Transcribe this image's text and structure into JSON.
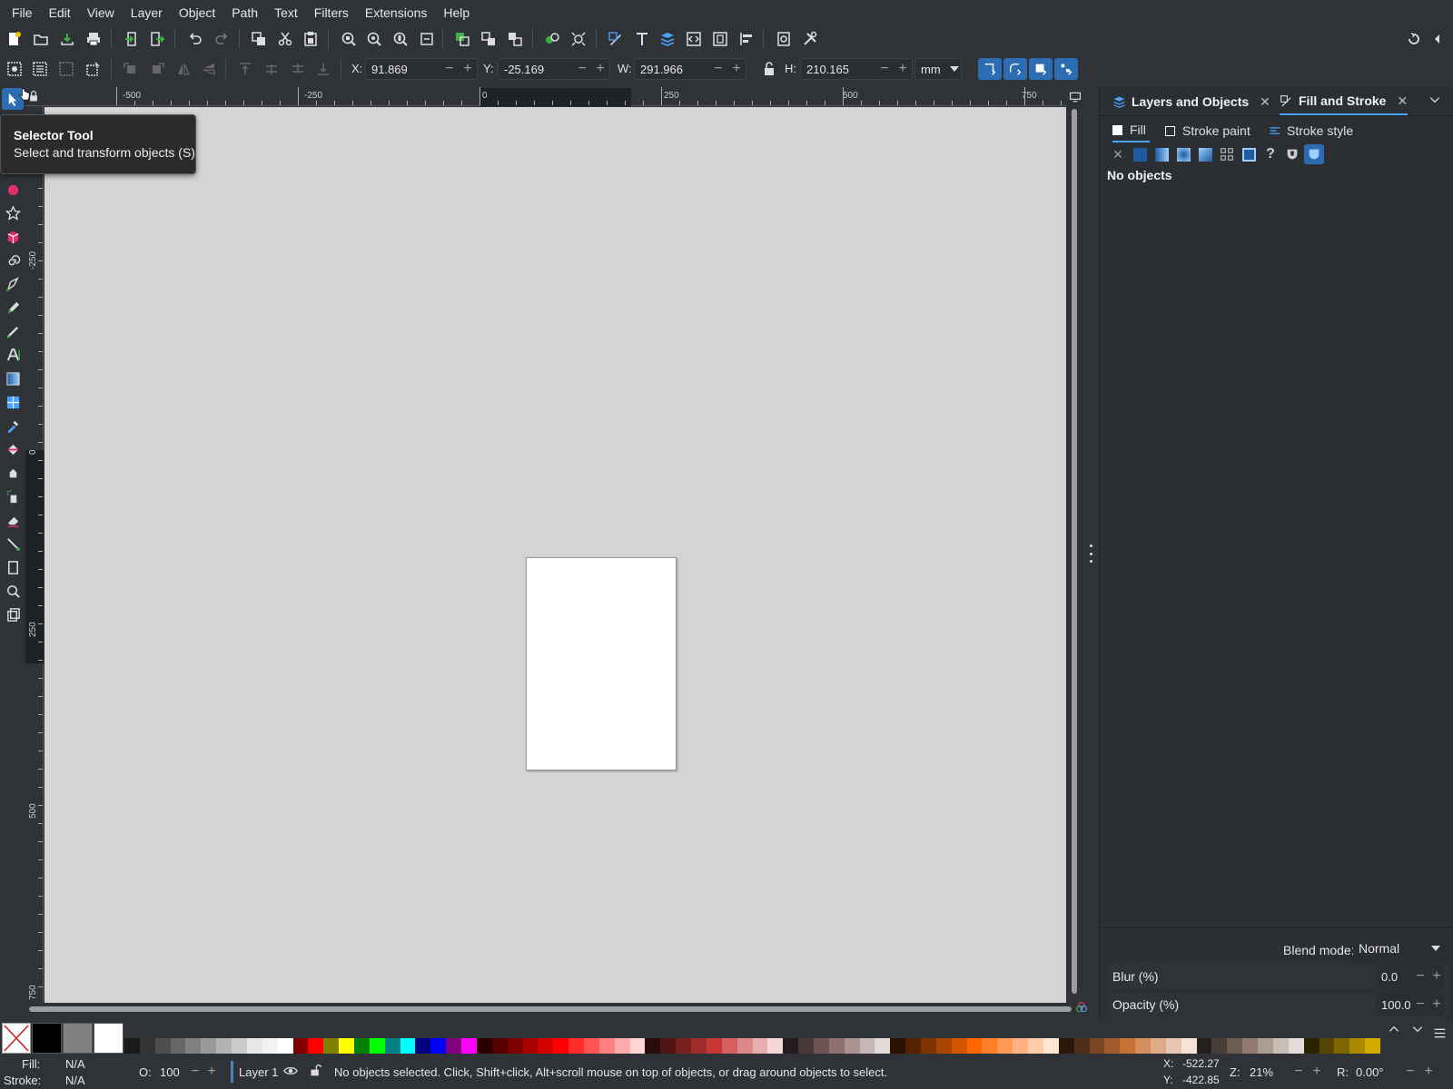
{
  "menu": [
    "File",
    "Edit",
    "View",
    "Layer",
    "Object",
    "Path",
    "Text",
    "Filters",
    "Extensions",
    "Help"
  ],
  "controls": {
    "x_label": "X:",
    "x_value": "91.869",
    "y_label": "Y:",
    "y_value": "-25.169",
    "w_label": "W:",
    "w_value": "291.966",
    "h_label": "H:",
    "h_value": "210.165",
    "unit": "mm"
  },
  "ruler": {
    "top_labels": [
      "-500",
      "-250",
      "0",
      "250",
      "500",
      "750"
    ],
    "left_labels": [
      "-250",
      "0",
      "250",
      "500",
      "750"
    ]
  },
  "tooltip": {
    "title": "Selector Tool",
    "description": "Select and transform objects (S)"
  },
  "panel": {
    "tab_layers": "Layers and Objects",
    "tab_fill": "Fill and Stroke",
    "subtab_fill": "Fill",
    "subtab_stroke_paint": "Stroke paint",
    "subtab_stroke_style": "Stroke style",
    "no_objects": "No objects",
    "blend_label": "Blend mode:",
    "blend_value": "Normal",
    "blur_label": "Blur (%)",
    "blur_value": "0.0",
    "opacity_label": "Opacity (%)",
    "opacity_value": "100.0"
  },
  "status": {
    "fill_label": "Fill:",
    "fill_value": "N/A",
    "stroke_label": "Stroke:",
    "stroke_value": "N/A",
    "o_label": "O:",
    "o_value": "100",
    "layer": "Layer 1",
    "message": "No objects selected. Click, Shift+click, Alt+scroll mouse on top of objects, or drag around objects to select.",
    "cursor_x_label": "X:",
    "cursor_x": "-522.27",
    "cursor_y_label": "Y:",
    "cursor_y": "-422.85",
    "zoom_label": "Z:",
    "zoom": "21%",
    "rotate_label": "R:",
    "rotate": "0.00°"
  },
  "palette": {
    "big_swatches": [
      "#000000",
      "#808080",
      "#ffffff"
    ],
    "swatches": [
      "#1a1a1a",
      "#333333",
      "#4d4d4d",
      "#666666",
      "#808080",
      "#999999",
      "#b3b3b3",
      "#cccccc",
      "#e6e6e6",
      "#f2f2f2",
      "#ffffff",
      "#800000",
      "#ff0000",
      "#808000",
      "#ffff00",
      "#008000",
      "#00ff00",
      "#008080",
      "#00ffff",
      "#000080",
      "#0000ff",
      "#800080",
      "#ff00ff",
      "#2b0000",
      "#550000",
      "#800000",
      "#aa0000",
      "#d40000",
      "#ff0000",
      "#ff2a2a",
      "#ff5555",
      "#ff8080",
      "#ffaaaa",
      "#ffd5d5",
      "#280b0b",
      "#501616",
      "#782121",
      "#a02c2c",
      "#c83737",
      "#d35f5f",
      "#de8787",
      "#e9afaf",
      "#f4d7d7",
      "#241c1c",
      "#483737",
      "#6c5353",
      "#916f6f",
      "#ac9393",
      "#c8b7b7",
      "#e3dbdb",
      "#2b1100",
      "#552200",
      "#803300",
      "#aa4400",
      "#d45500",
      "#ff6600",
      "#ff7f2a",
      "#ff9955",
      "#ffb380",
      "#ffccaa",
      "#ffe6d5",
      "#28170b",
      "#502d16",
      "#784421",
      "#a05a2c",
      "#c87137",
      "#d38d5f",
      "#deaa87",
      "#e9c6af",
      "#f4e3d7",
      "#241f1c",
      "#483e37",
      "#6c5d53",
      "#917c6f",
      "#ac9d93",
      "#c8beb7",
      "#e3dedb",
      "#2b2200",
      "#554400",
      "#806600",
      "#aa8800",
      "#d4aa00"
    ]
  }
}
